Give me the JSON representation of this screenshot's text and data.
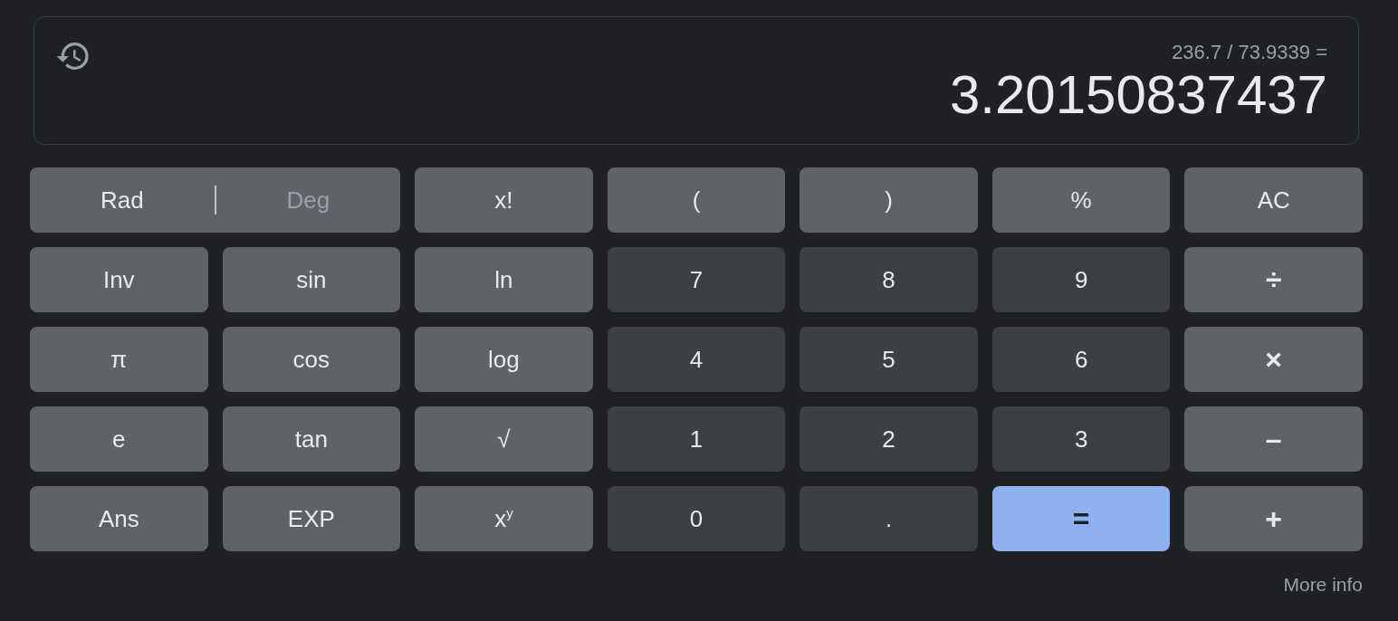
{
  "display": {
    "expression": "236.7 / 73.9339 =",
    "result": "3.20150837437"
  },
  "angle_modes": [
    {
      "label": "Rad",
      "selected": true
    },
    {
      "label": "Deg",
      "selected": false
    }
  ],
  "keys": [
    {
      "label": "x!",
      "kind": "function"
    },
    {
      "label": "(",
      "kind": "function"
    },
    {
      "label": ")",
      "kind": "function"
    },
    {
      "label": "%",
      "kind": "function"
    },
    {
      "label": "AC",
      "kind": "function"
    },
    {
      "label": "Inv",
      "kind": "function"
    },
    {
      "label": "sin",
      "kind": "function"
    },
    {
      "label": "ln",
      "kind": "function"
    },
    {
      "label": "7",
      "kind": "digit"
    },
    {
      "label": "8",
      "kind": "digit"
    },
    {
      "label": "9",
      "kind": "digit"
    },
    {
      "label": "÷",
      "kind": "operator"
    },
    {
      "label": "π",
      "kind": "function"
    },
    {
      "label": "cos",
      "kind": "function"
    },
    {
      "label": "log",
      "kind": "function"
    },
    {
      "label": "4",
      "kind": "digit"
    },
    {
      "label": "5",
      "kind": "digit"
    },
    {
      "label": "6",
      "kind": "digit"
    },
    {
      "label": "×",
      "kind": "operator"
    },
    {
      "label": "e",
      "kind": "function"
    },
    {
      "label": "tan",
      "kind": "function"
    },
    {
      "label": "√",
      "kind": "function"
    },
    {
      "label": "1",
      "kind": "digit"
    },
    {
      "label": "2",
      "kind": "digit"
    },
    {
      "label": "3",
      "kind": "digit"
    },
    {
      "label": "–",
      "kind": "operator"
    },
    {
      "label": "Ans",
      "kind": "function"
    },
    {
      "label": "EXP",
      "kind": "function"
    },
    {
      "label": "x$^{y}$",
      "kind": "function"
    },
    {
      "label": "0",
      "kind": "digit"
    },
    {
      "label": ".",
      "kind": "digit"
    },
    {
      "label": "=",
      "kind": "equals"
    },
    {
      "label": "+",
      "kind": "operator"
    }
  ],
  "more_info": "More info"
}
